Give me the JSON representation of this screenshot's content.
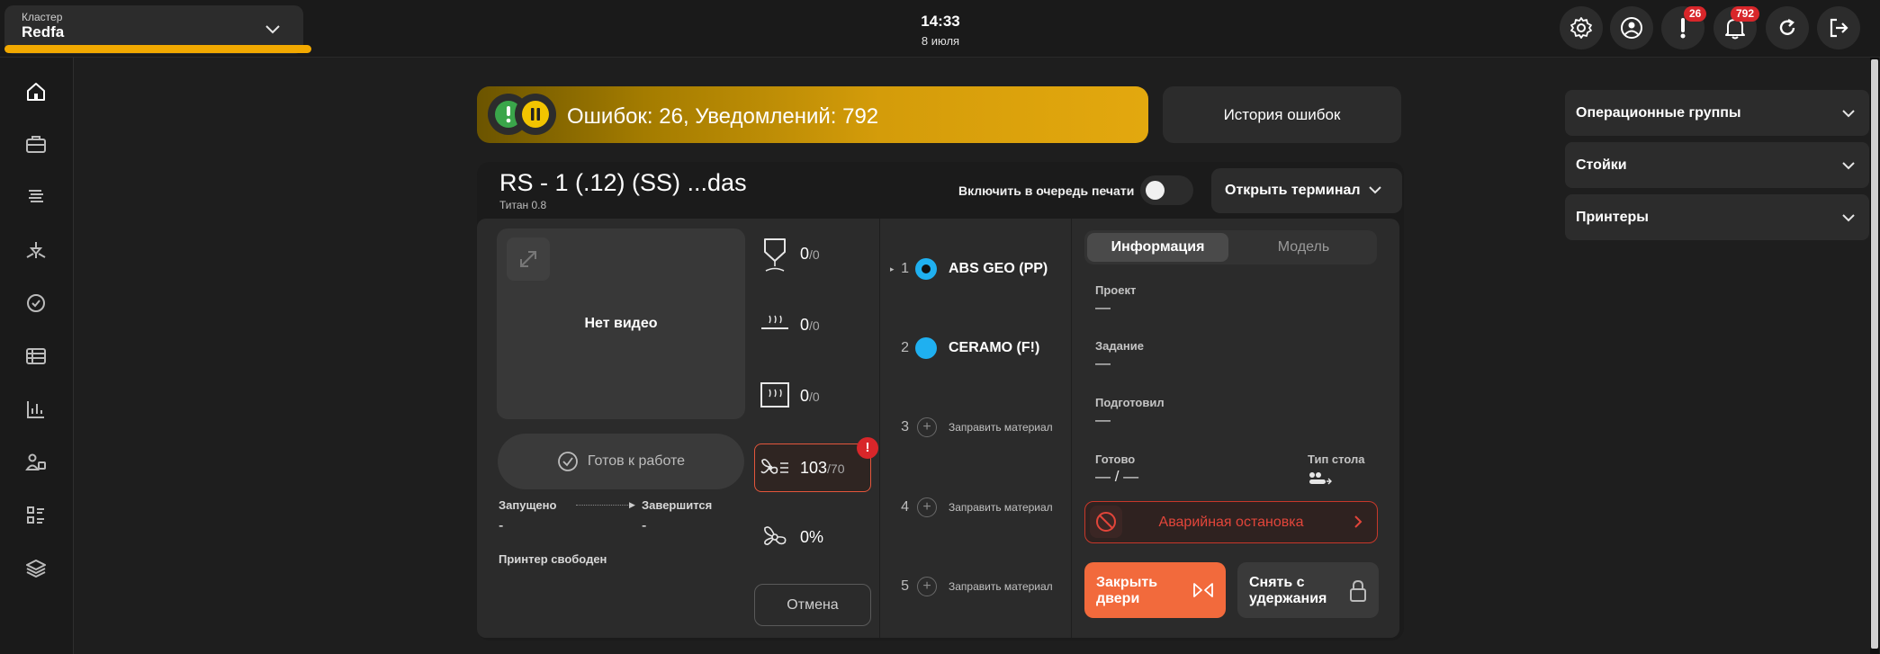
{
  "header": {
    "cluster_label": "Кластер",
    "cluster_value": "Redfa",
    "time": "14:33",
    "date": "8 июля",
    "alerts_badge": "26",
    "notifications_badge": "792"
  },
  "alert_bar": {
    "text": "Ошибок: 26, Уведомлений: 792",
    "history_button": "История ошибок"
  },
  "printer": {
    "title": "RS - 1 (.12) (SS) ...das",
    "subtitle": "Титан 0.8",
    "queue_label": "Включить в очередь печати",
    "terminal_button": "Открыть терминал",
    "video_label": "Нет видео",
    "ready_button": "Готов к работе",
    "started_label": "Запущено",
    "finish_label": "Завершится",
    "started_value": "-",
    "finish_value": "-",
    "status_text": "Принтер свободен",
    "cancel_button": "Отмена",
    "temps": [
      {
        "icon": "nozzle-icon",
        "current": "0",
        "target": "/0"
      },
      {
        "icon": "bed-heat-icon",
        "current": "0",
        "target": "/0"
      },
      {
        "icon": "chamber-heat-icon",
        "current": "0",
        "target": "/0"
      },
      {
        "icon": "fan-heater-icon",
        "current": "103",
        "target": "/70"
      },
      {
        "icon": "fan-icon",
        "current": "0%",
        "target": ""
      }
    ],
    "fan_error_badge": "!",
    "materials": [
      {
        "number": "1",
        "marker": "▸",
        "name": "ABS GEO (PP)",
        "active": true
      },
      {
        "number": "2",
        "name": "CERAMO (F!)"
      },
      {
        "number": "3",
        "add_label": "Заправить материал"
      },
      {
        "number": "4",
        "add_label": "Заправить материал"
      },
      {
        "number": "5",
        "add_label": "Заправить материал"
      }
    ],
    "tabs": {
      "info": "Информация",
      "model": "Модель"
    },
    "info": {
      "project_label": "Проект",
      "project_value": "—",
      "task_label": "Задание",
      "task_value": "—",
      "prepared_label": "Подготовил",
      "prepared_value": "—",
      "ready_label": "Готово",
      "ready_value": "— / —",
      "table_type_label": "Тип стола"
    },
    "emergency_button": "Аварийная остановка",
    "close_doors_button": "Закрыть двери",
    "unhold_button": "Снять с удержания"
  },
  "right_panel": {
    "items": [
      {
        "label": "Операционные группы"
      },
      {
        "label": "Стойки"
      },
      {
        "label": "Принтеры"
      }
    ]
  },
  "colors": {
    "accent": "#f2a900",
    "danger": "#d8262a",
    "orange_button": "#f26a3c",
    "material_dot": "#1fb0f0"
  }
}
